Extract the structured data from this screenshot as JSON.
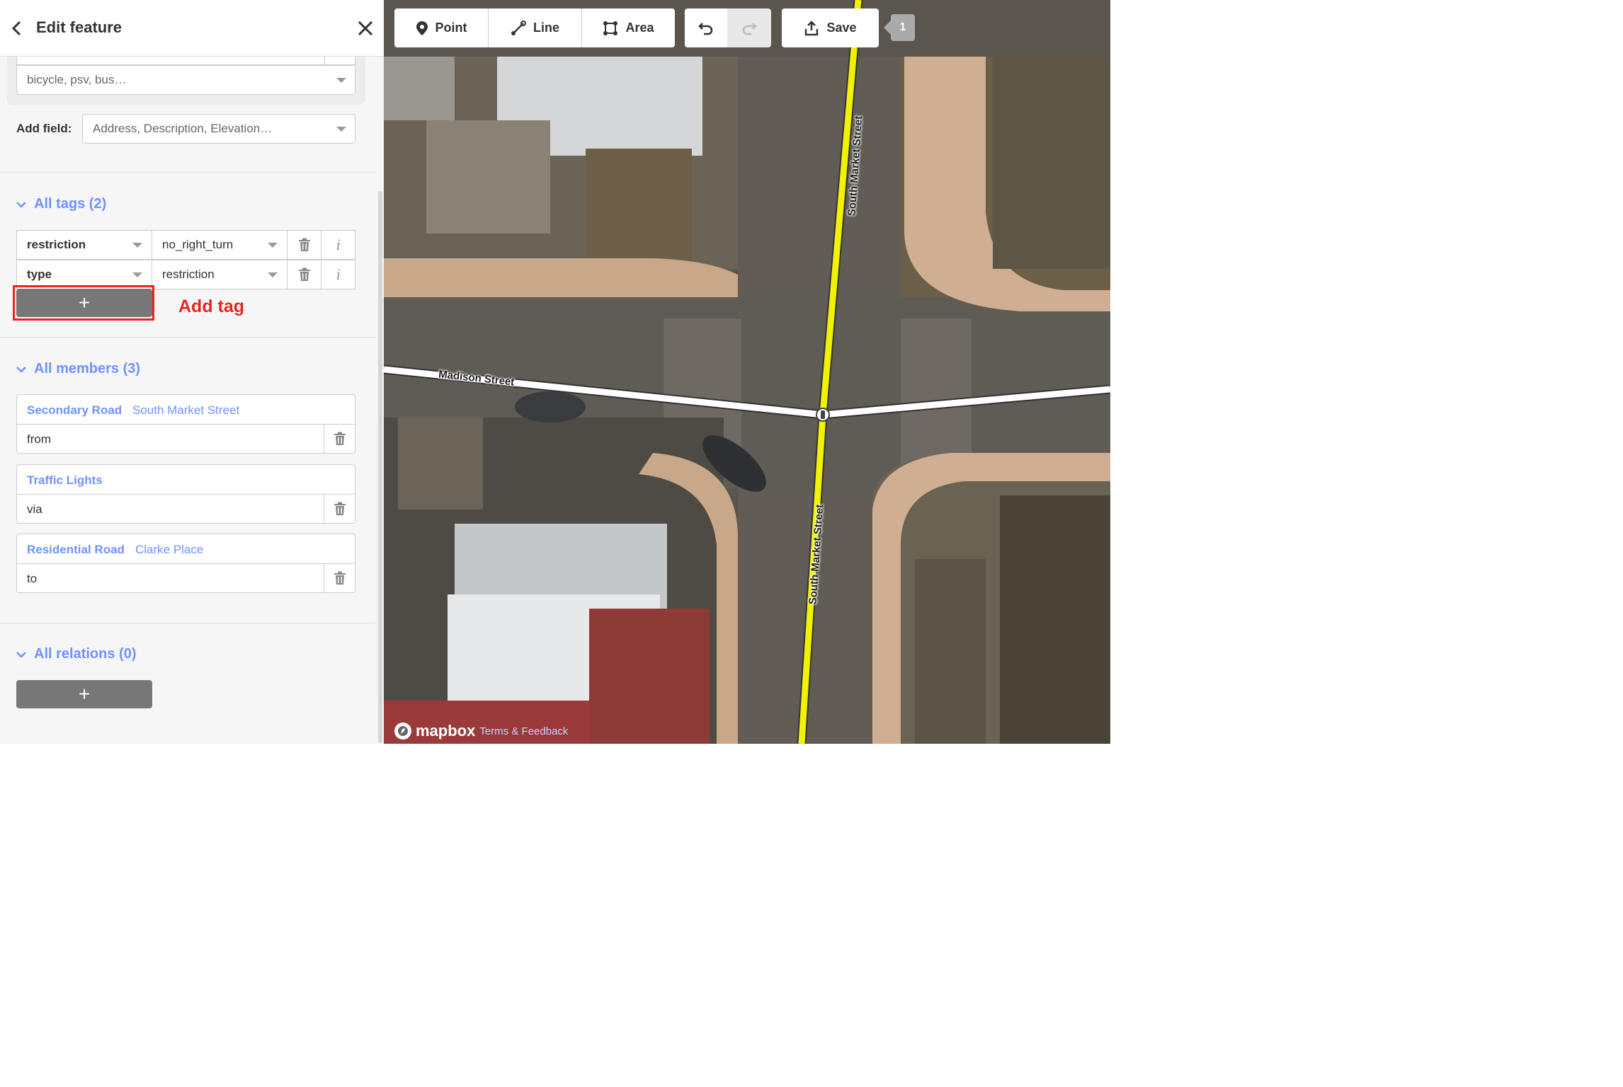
{
  "sidebar": {
    "header": {
      "title": "Edit feature"
    },
    "access_field": {
      "placeholder": "bicycle, psv, bus…"
    },
    "add_field": {
      "label": "Add field:",
      "placeholder": "Address, Description, Elevation…"
    },
    "tags": {
      "heading": "All tags (2)",
      "rows": [
        {
          "key": "restriction",
          "value": "no_right_turn"
        },
        {
          "key": "type",
          "value": "restriction"
        }
      ],
      "add_button": "+",
      "annotation": "Add tag"
    },
    "members": {
      "heading": "All members (3)",
      "items": [
        {
          "type": "Secondary Road",
          "name": "South Market Street",
          "role": "from"
        },
        {
          "type": "Traffic Lights",
          "name": "",
          "role": "via"
        },
        {
          "type": "Residential Road",
          "name": "Clarke Place",
          "role": "to"
        }
      ]
    },
    "relations": {
      "heading": "All relations (0)",
      "add_button": "+"
    }
  },
  "toolbar": {
    "point": "Point",
    "line": "Line",
    "area": "Area",
    "save": "Save",
    "save_count": "1"
  },
  "map": {
    "streets": {
      "market_north": "South Market Street",
      "market_south": "South Market Street",
      "madison": "Madison Street"
    },
    "attribution": {
      "logo": "mapbox",
      "terms": "Terms & Feedback"
    }
  },
  "colors": {
    "accent": "#7092ff",
    "highlight": "#e8241c",
    "secondary_road": "#f2f200"
  }
}
